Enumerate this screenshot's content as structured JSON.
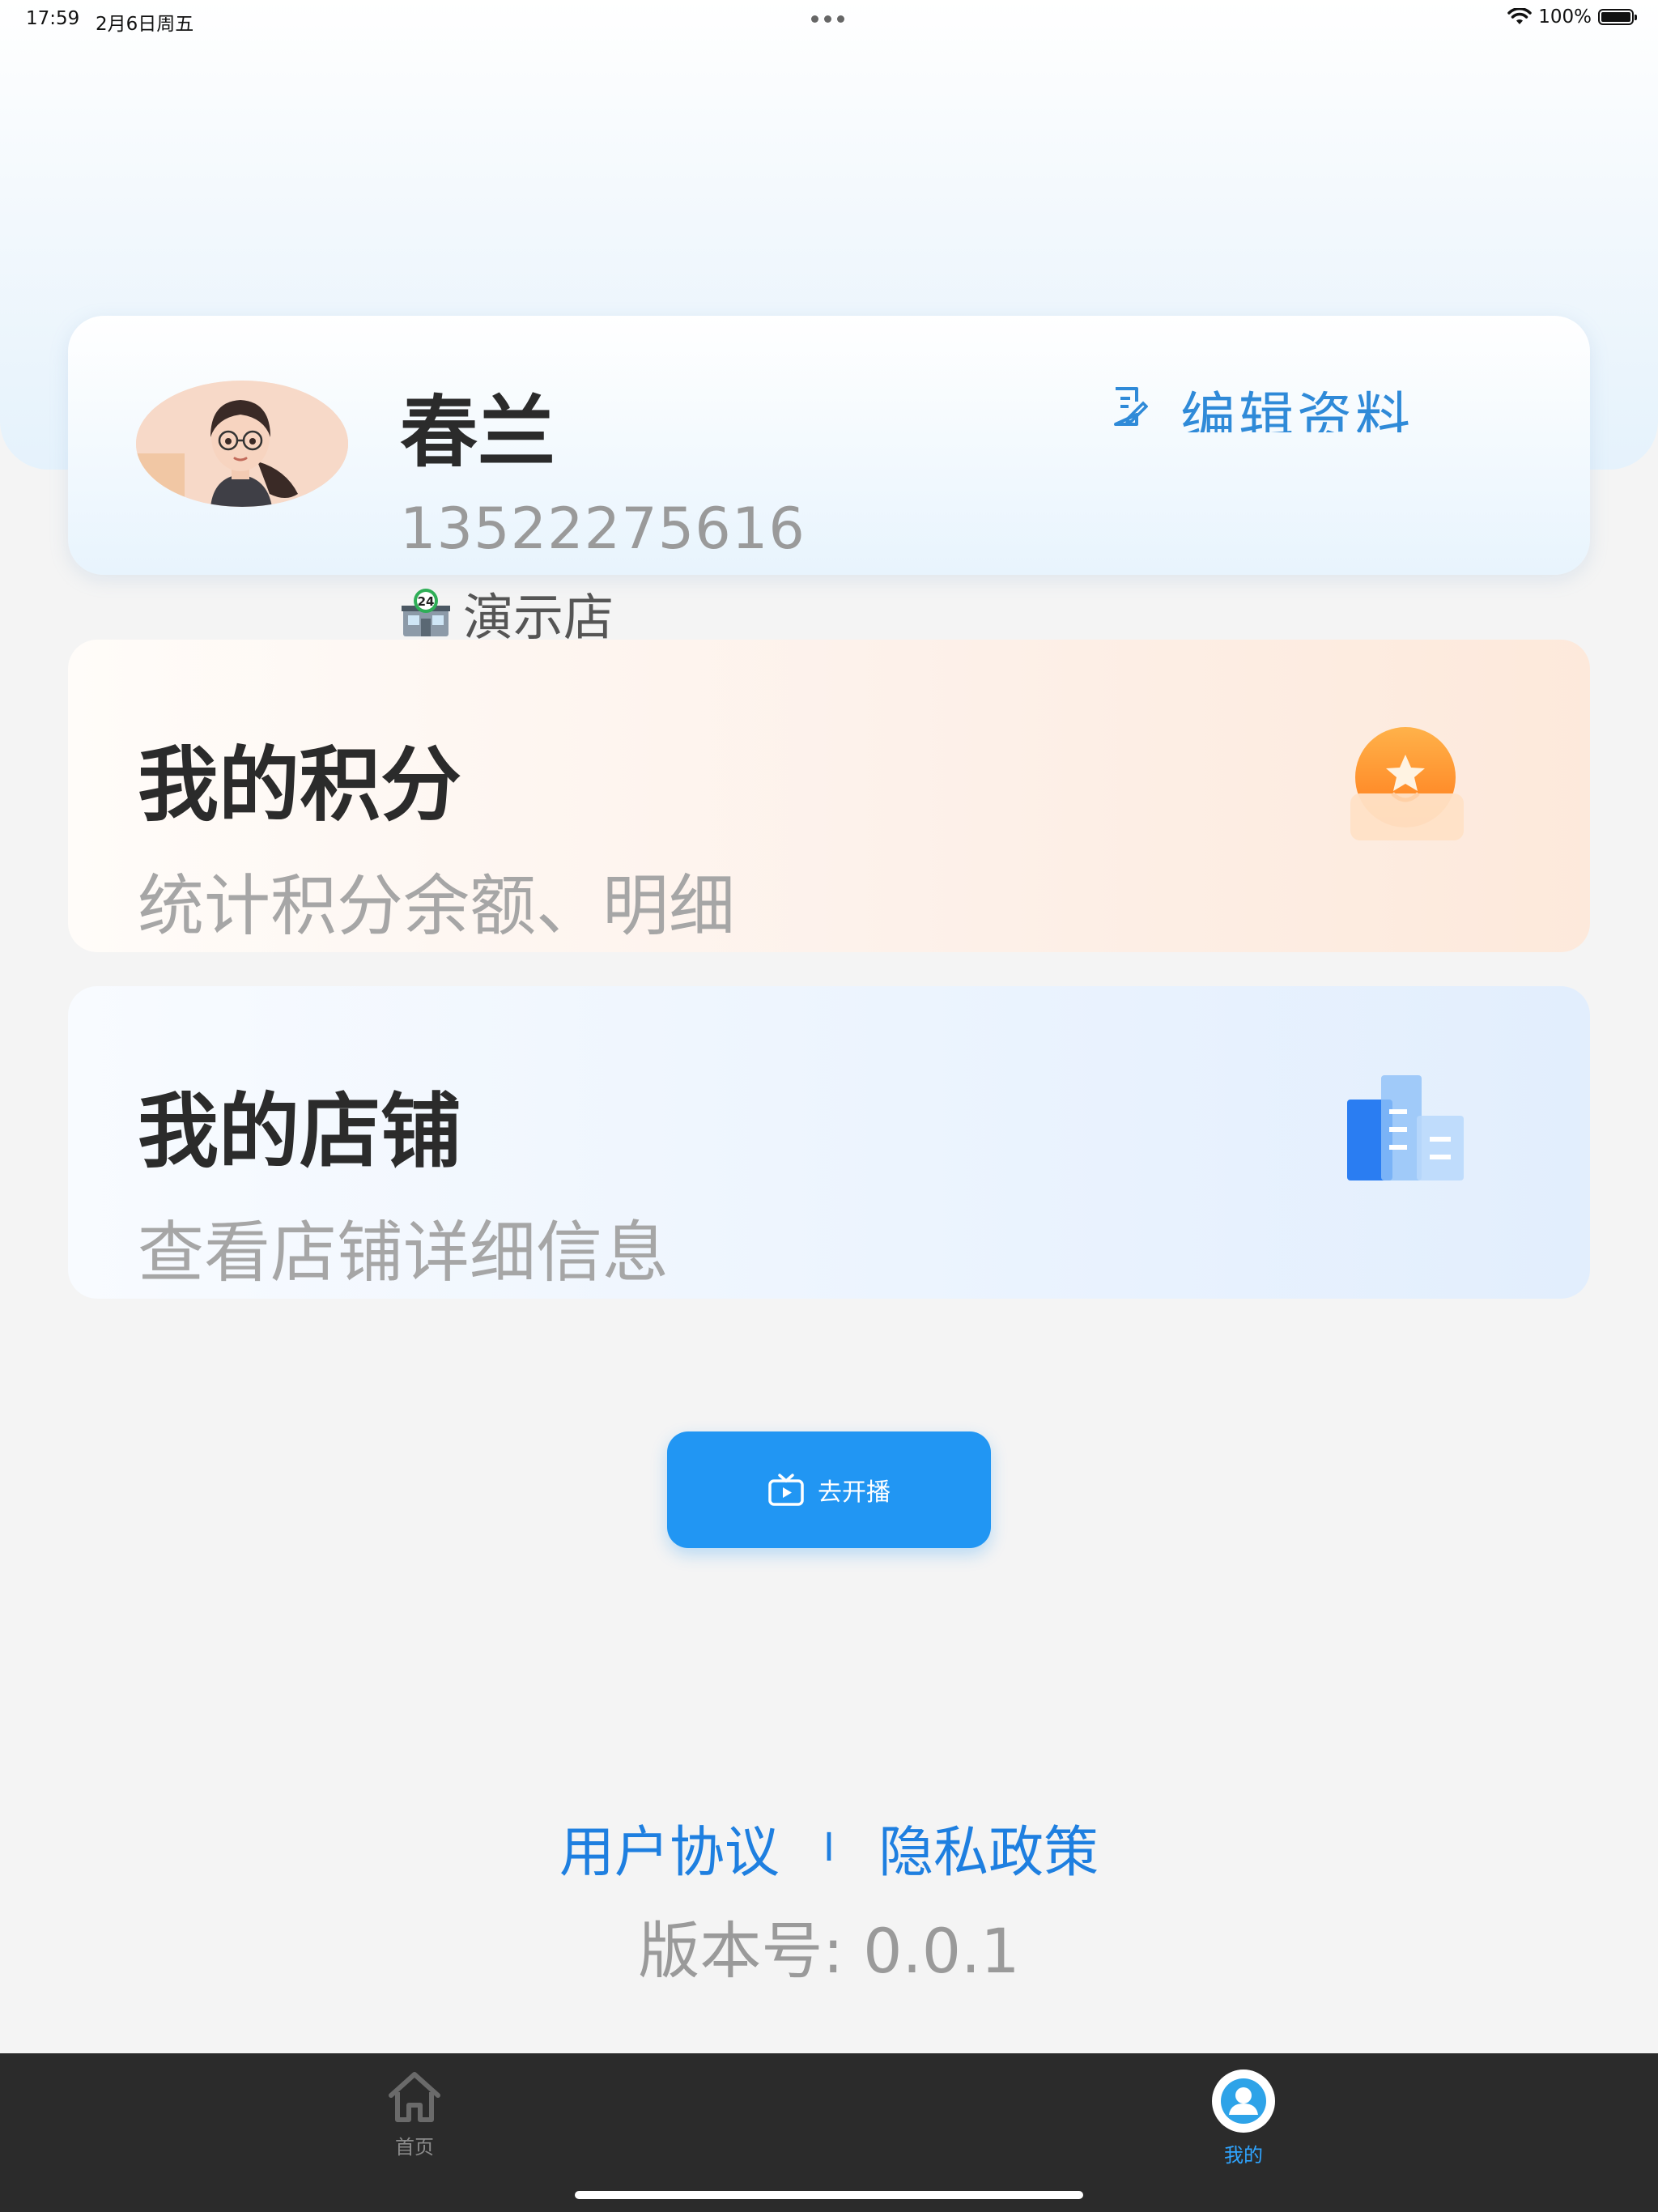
{
  "status_bar": {
    "time": "17:59",
    "date": "2月6日周五",
    "battery": "100%"
  },
  "profile": {
    "name": "春兰",
    "phone": "13522275616",
    "store": "演示店",
    "edit_label": "编辑资料"
  },
  "cards": [
    {
      "title": "我的积分",
      "subtitle": "统计积分余额、明细",
      "icon": "points-coin-icon"
    },
    {
      "title": "我的店铺",
      "subtitle": "查看店铺详细信息",
      "icon": "shop-building-icon"
    }
  ],
  "live_button": {
    "label": "去开播",
    "icon": "tv-play-icon"
  },
  "footer": {
    "user_agreement": "用户协议",
    "separator": "I",
    "privacy_policy": "隐私政策",
    "version": "版本号: 0.0.1"
  },
  "tabs": [
    {
      "label": "首页",
      "icon": "home-icon",
      "active": false
    },
    {
      "label": "我的",
      "icon": "user-icon",
      "active": true
    }
  ],
  "colors": {
    "accent": "#2196f3",
    "link": "#1e7fe0",
    "edit": "#2f8ad8",
    "tab_bar": "#2b2b2b",
    "tab_active": "#2fa4ff"
  }
}
